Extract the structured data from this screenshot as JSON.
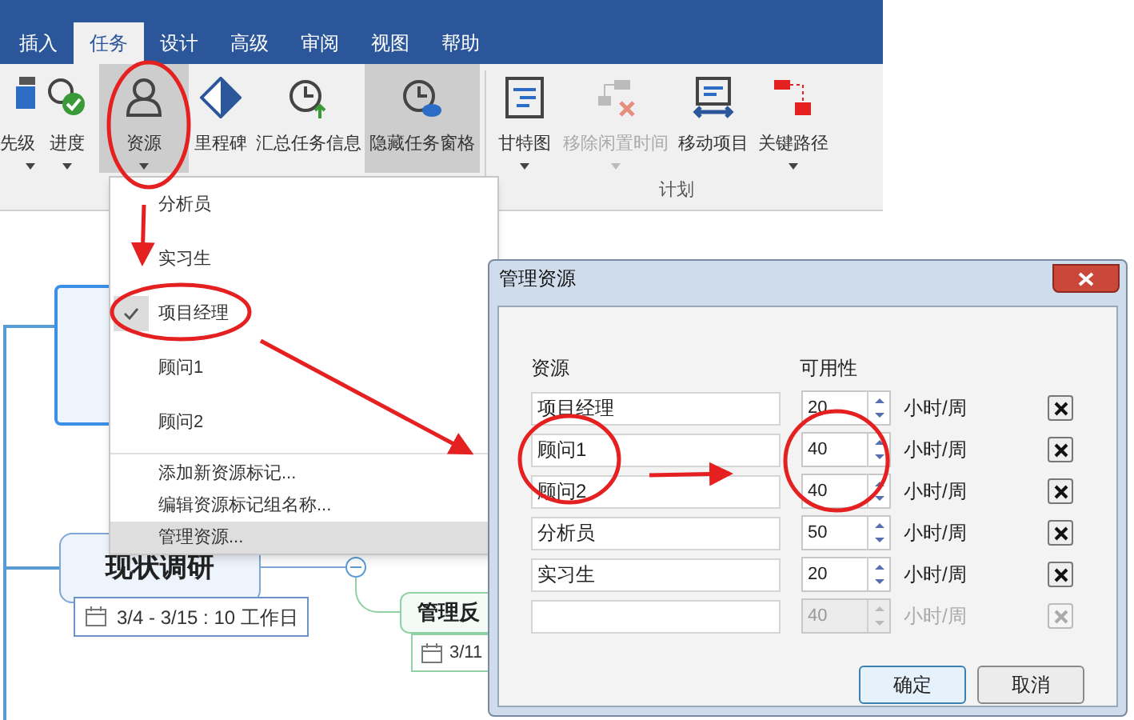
{
  "tabs": [
    {
      "label": "插入",
      "selected": false
    },
    {
      "label": "任务",
      "selected": true
    },
    {
      "label": "设计",
      "selected": false
    },
    {
      "label": "高级",
      "selected": false
    },
    {
      "label": "审阅",
      "selected": false
    },
    {
      "label": "视图",
      "selected": false
    },
    {
      "label": "帮助",
      "selected": false
    }
  ],
  "ribbon": {
    "buttons": [
      {
        "label": "先级",
        "kind": "priority",
        "highlighted": false,
        "disabled": false,
        "dropdown": true
      },
      {
        "label": "进度",
        "kind": "progress",
        "highlighted": false,
        "disabled": false,
        "dropdown": true
      },
      {
        "label": "资源",
        "kind": "resource",
        "highlighted": true,
        "disabled": false,
        "dropdown": true
      },
      {
        "label": "里程碑",
        "kind": "milestone",
        "highlighted": false,
        "disabled": false,
        "dropdown": false
      },
      {
        "label": "汇总任务信息",
        "kind": "rollup",
        "highlighted": false,
        "disabled": false,
        "dropdown": false
      },
      {
        "label": "隐藏任务窗格",
        "kind": "hidepane",
        "highlighted": true,
        "disabled": false,
        "dropdown": false
      },
      {
        "label": "甘特图",
        "kind": "gantt",
        "highlighted": false,
        "disabled": false,
        "dropdown": true
      },
      {
        "label": "移除闲置时间",
        "kind": "removeidle",
        "highlighted": false,
        "disabled": true,
        "dropdown": true
      },
      {
        "label": "移动项目",
        "kind": "moveproject",
        "highlighted": false,
        "disabled": false,
        "dropdown": false
      },
      {
        "label": "关键路径",
        "kind": "criticalpath",
        "highlighted": false,
        "disabled": false,
        "dropdown": true
      }
    ],
    "group_label": "计划"
  },
  "mind_map": {
    "topics": [
      {
        "title": "现状调研",
        "dates": "3/4 - 3/15 : 10 工作日"
      },
      {
        "title": "管理反",
        "dates": "3/11"
      }
    ]
  },
  "resource_menu": {
    "items": [
      {
        "label": "分析员",
        "checked": false
      },
      {
        "label": "实习生",
        "checked": false
      },
      {
        "label": "项目经理",
        "checked": true
      },
      {
        "label": "顾问1",
        "checked": false
      },
      {
        "label": "顾问2",
        "checked": false
      }
    ],
    "commands": [
      {
        "label": "添加新资源标记...",
        "highlighted": false
      },
      {
        "label": "编辑资源标记组名称...",
        "highlighted": false
      },
      {
        "label": "管理资源...",
        "highlighted": true
      }
    ]
  },
  "dialog": {
    "title": "管理资源",
    "columns": [
      "资源",
      "可用性"
    ],
    "rows": [
      {
        "name": "项目经理",
        "hours": "20",
        "unit": "小时/周",
        "disabled": false
      },
      {
        "name": "顾问1",
        "hours": "40",
        "unit": "小时/周",
        "disabled": false
      },
      {
        "name": "顾问2",
        "hours": "40",
        "unit": "小时/周",
        "disabled": false
      },
      {
        "name": "分析员",
        "hours": "50",
        "unit": "小时/周",
        "disabled": false
      },
      {
        "name": "实习生",
        "hours": "20",
        "unit": "小时/周",
        "disabled": false
      },
      {
        "hours": "40",
        "unit": "小时/周",
        "disabled": true
      }
    ],
    "buttons": [
      "确定",
      "取消"
    ]
  }
}
